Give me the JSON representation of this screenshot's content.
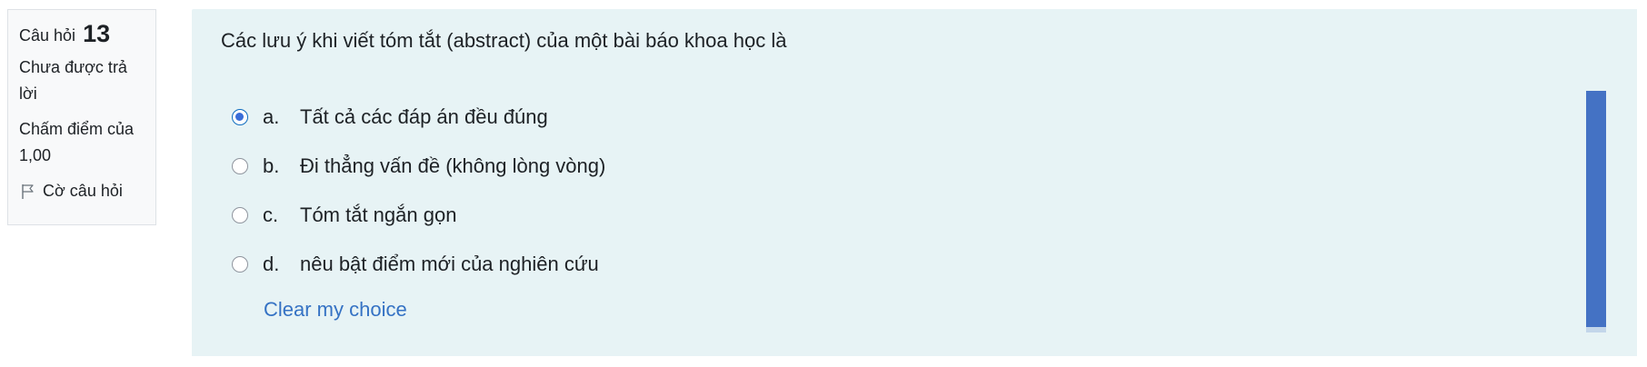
{
  "info": {
    "question_label": "Câu hỏi",
    "question_number": "13",
    "state_line1": "Chưa được trả",
    "state_line2": "lời",
    "grade_line1": "Chấm điểm của",
    "grade_line2": "1,00",
    "flag_label": "Cờ câu hỏi",
    "flag_icon": "flag-icon"
  },
  "question": {
    "text": "Các lưu ý khi viết tóm tắt (abstract) của một bài báo khoa học là"
  },
  "answers": [
    {
      "letter": "a.",
      "text": "Tất cả các đáp án đều đúng",
      "selected": true
    },
    {
      "letter": "b.",
      "text": "Đi thẳng vấn đề (không lòng vòng)",
      "selected": false
    },
    {
      "letter": "c.",
      "text": "Tóm tắt ngắn gọn",
      "selected": false
    },
    {
      "letter": "d.",
      "text": "nêu bật điểm mới của nghiên cứu",
      "selected": false
    }
  ],
  "clear_choice": "Clear my choice",
  "colors": {
    "panel_bg": "#e7f3f5",
    "link": "#3572c4",
    "accent_bar": "#4472c4"
  }
}
